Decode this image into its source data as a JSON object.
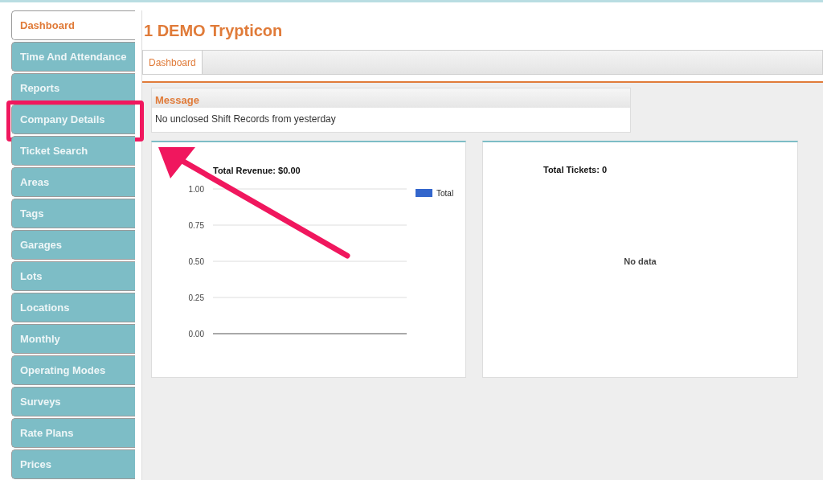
{
  "sidebar": {
    "items": [
      {
        "label": "Dashboard",
        "selected": true,
        "highlighted": false
      },
      {
        "label": "Time And Attendance",
        "selected": false,
        "highlighted": false
      },
      {
        "label": "Reports",
        "selected": false,
        "highlighted": false
      },
      {
        "label": "Company Details",
        "selected": false,
        "highlighted": true
      },
      {
        "label": "Ticket Search",
        "selected": false,
        "highlighted": false
      },
      {
        "label": "Areas",
        "selected": false,
        "highlighted": false
      },
      {
        "label": "Tags",
        "selected": false,
        "highlighted": false
      },
      {
        "label": "Garages",
        "selected": false,
        "highlighted": false
      },
      {
        "label": "Lots",
        "selected": false,
        "highlighted": false
      },
      {
        "label": "Locations",
        "selected": false,
        "highlighted": false
      },
      {
        "label": "Monthly",
        "selected": false,
        "highlighted": false
      },
      {
        "label": "Operating Modes",
        "selected": false,
        "highlighted": false
      },
      {
        "label": "Surveys",
        "selected": false,
        "highlighted": false
      },
      {
        "label": "Rate Plans",
        "selected": false,
        "highlighted": false
      },
      {
        "label": "Prices",
        "selected": false,
        "highlighted": false
      }
    ]
  },
  "page_title": "1 DEMO Trypticon",
  "tabs": [
    {
      "label": "Dashboard",
      "selected": true
    }
  ],
  "message": {
    "title": "Message",
    "text": "No unclosed Shift Records from yesterday"
  },
  "revenue_chart": {
    "chart_data": {
      "type": "line",
      "grid": true,
      "title": "Total Revenue: $0.00",
      "ylim": [
        0,
        1
      ],
      "yticks": [
        {
          "value": 0,
          "label": "0.00"
        },
        {
          "value": 0.25,
          "label": "0.25"
        },
        {
          "value": 0.5,
          "label": "0.50"
        },
        {
          "value": 0.75,
          "label": "0.75"
        },
        {
          "value": 1,
          "label": "1.00"
        }
      ],
      "series": [
        {
          "name": "Total",
          "color": "#3366cc"
        }
      ]
    }
  },
  "tickets_chart": {
    "title": "Total Tickets: 0",
    "empty_text": "No data"
  },
  "annotations": [
    {
      "kind": "arrow"
    }
  ]
}
